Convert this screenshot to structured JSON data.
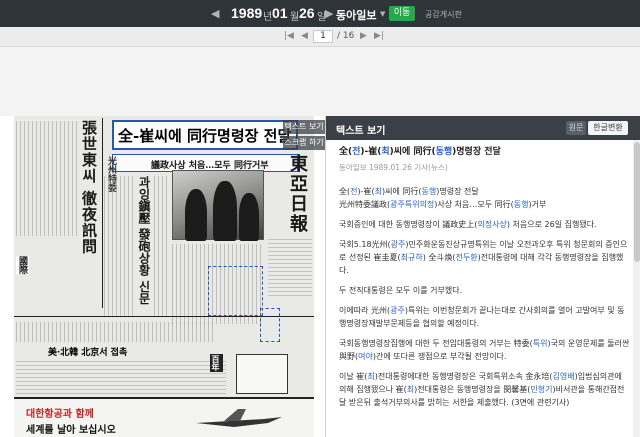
{
  "nav": {
    "prev_arrow": "◀",
    "year": "1989",
    "year_unit": "년",
    "month": "01",
    "month_unit": "월",
    "day": "26",
    "day_unit": "일",
    "next_arrow": "▶",
    "caret": "▼",
    "newspaper": "동아일보",
    "move_button": "이동",
    "board_link": "공감게시판"
  },
  "pager": {
    "first": "|◀",
    "prev": "◀",
    "current": "1",
    "total": "/ 16",
    "next": "▶",
    "last": "▶|"
  },
  "viewer": {
    "text_view_tab": "텍스트 보기",
    "scrap_tab": "스크랩 하기"
  },
  "newspaper_image": {
    "headline": "全-崔씨에 同行명령장 전달",
    "subheadline": "議政사상 처음…모두 同行거부",
    "column_title_1": "張世東씨 徹夜訊問",
    "column_title_2": "과잉鎭壓 發砲상황 신문",
    "masthead": "東亞日報",
    "bottom_story": "美·北韓 北京서 접촉",
    "ad_line_1": "대한항공과 함께",
    "ad_line_2": "세계를 날아 보십시오"
  },
  "text_panel": {
    "title": "텍스트 보기",
    "btn_original": "원문",
    "btn_convert": "한글변환",
    "article_title": "全(전)-崔(최)씨에 同行(동행)명령장 전달",
    "meta": "동아일보 1989.01.26 기사(뉴스)",
    "para1_a": "全(전)-崔(최)씨에 同行(동행)명령장 전달",
    "para1_b": "光州特委議政(광주특위의정)사상 처음…모두 同行(동행)거부",
    "para2": "국회증인에 대한 동행명령장이 議政史上(의정사상) 처음으로 26일 집행됐다.",
    "para3": "국회5.18光州(광주)민주화운동진상규명특위는 이날 오전과오후 특위 청문회의 증인으로 선정된 崔圭夏(최규하) 全斗煥(전두환)전대통령에 대해 각각 동행명령장을 집행했다.",
    "para4": "두 전직대통령은 모두 이를 거부했다.",
    "para5": "이에따라 光州(광주)특위는 이번청문회가 끝나는대로 간사회의를 열어 고발여부 및 동행명령장재발부문제등을 협의할 예정이다.",
    "para6": "국회동행명령장집행에 대한 두 전임대통령의 거부는 特委(특위)국의 운영문제를 둘러싼 與野(여야)간에 또다른 쟁점으로 부각될 전망이다.",
    "para7": "이날 崔(최)전대통령에대한 동행명령장은 국회특위소속 金永培(김영배)입법심의관에 의해 집행됐으나 崔(최)전대통령은 동행명령장을 閔馨基(민형기)비서관을 통해간접전달 받은뒤 출석거부의사를 밝히는 서한을 제출했다. (3면에 관련기사)"
  },
  "colors": {
    "topbar_bg": "#2f3439",
    "accent_green": "#27a84a",
    "link_blue": "#2a62c9",
    "selection_blue": "#2656b0"
  }
}
